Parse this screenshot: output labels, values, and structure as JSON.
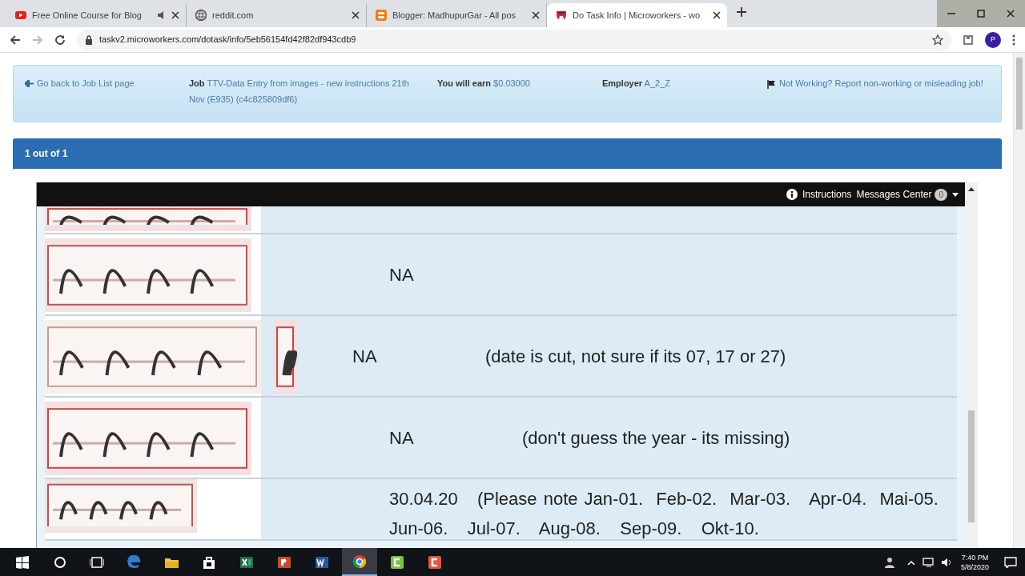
{
  "browser": {
    "tabs": [
      {
        "title": "Free Online Course for Blog",
        "kind": "video",
        "audio": true,
        "selected": false
      },
      {
        "title": "reddit.com",
        "kind": "globe",
        "audio": false,
        "selected": false
      },
      {
        "title": "Blogger: MadhupurGar - All pos",
        "kind": "blog",
        "audio": false,
        "selected": false
      },
      {
        "title": "Do Task Info | Microworkers - wo",
        "kind": "worker",
        "audio": false,
        "selected": true
      }
    ],
    "url": "taskv2.microworkers.com/dotask/info/5eb56154fd42f82df943cdb9",
    "profile": "P"
  },
  "info": {
    "back": "Go back to Job List page",
    "job_label": "Job",
    "job_text": "TTV-Data Entry from images - new instructions 21th Nov (E935) (c4c825809df6)",
    "earn_label": "You will earn",
    "earn_value": "$0.03000",
    "employer_label": "Employer",
    "employer_value": "A_2_Z",
    "report": "Not Working? Report non-working or misleading job!"
  },
  "header": "1 out of 1",
  "frame": {
    "instructions": "Instructions",
    "messages": "Messages Center",
    "messages_count": "0",
    "rows": [
      {
        "kind": "partial"
      },
      {
        "kind": "normal",
        "answer": "NA"
      },
      {
        "kind": "normal",
        "answer": "NA",
        "note": "(date is cut, not sure if its 07, 17 or 27)"
      },
      {
        "kind": "normal",
        "answer": "NA",
        "note": "(don't guess the year - its missing)"
      },
      {
        "kind": "inline",
        "text": "30.04.20   (Please note Jan-01.  Feb-02.  Mar-03.   Apr-04.  Mai-05.   Jun-06.   Jul-07.   Aug-08.   Sep-09.   Okt-10."
      }
    ]
  },
  "taskbar": {
    "apps": [
      {
        "kind": "edge",
        "selected": false
      },
      {
        "kind": "folder",
        "selected": false
      },
      {
        "kind": "store",
        "selected": false
      },
      {
        "kind": "excel",
        "selected": false
      },
      {
        "kind": "powerpoint",
        "selected": false
      },
      {
        "kind": "word",
        "selected": false
      },
      {
        "kind": "chrome",
        "selected": true
      },
      {
        "kind": "green",
        "selected": false
      },
      {
        "kind": "orange",
        "selected": false
      }
    ],
    "time": "7:40 PM",
    "date": "5/8/2020"
  }
}
